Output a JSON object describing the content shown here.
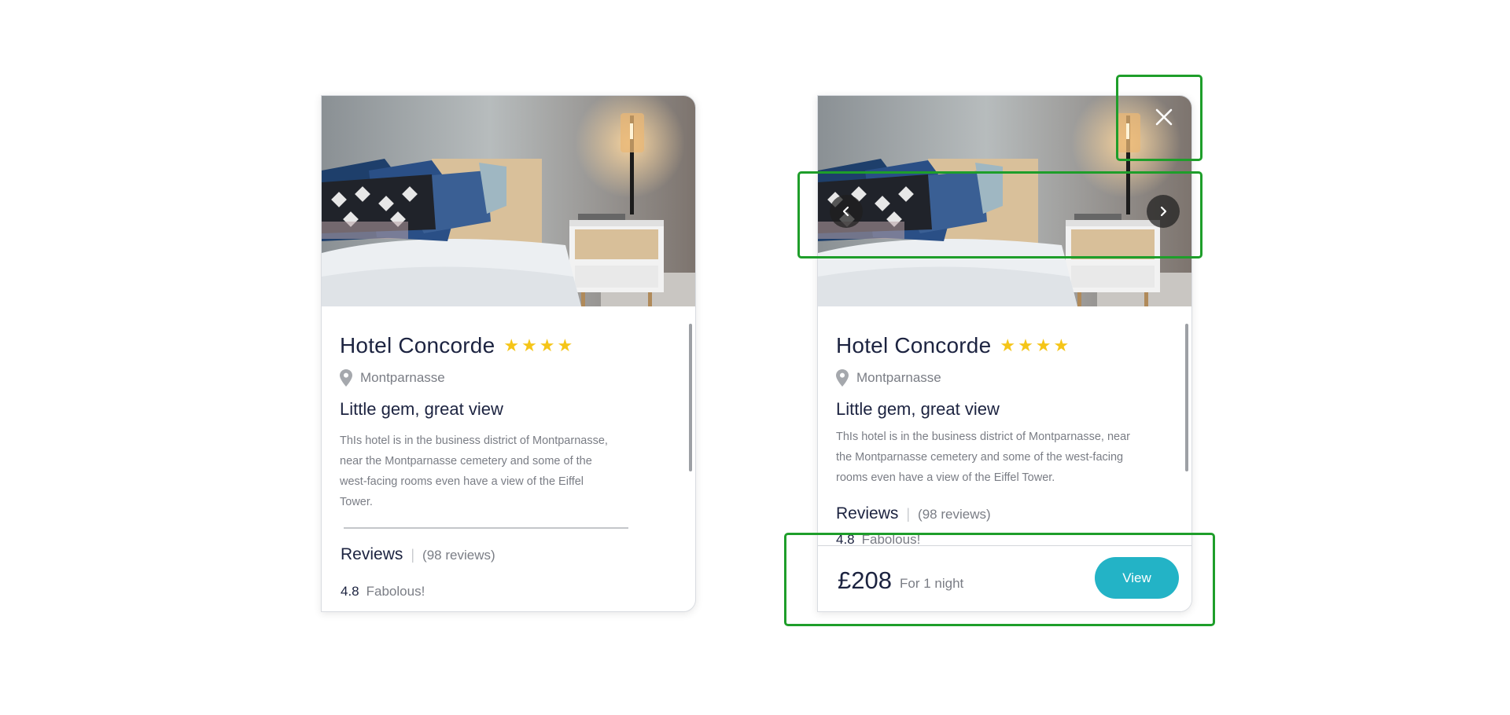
{
  "cards": [
    {
      "hotel_name": "Hotel Concorde",
      "stars": "★★★★",
      "location": "Montparnasse",
      "headline": "Little gem, great view",
      "description": [
        "ThIs hotel is in the business district of Montparnasse,",
        "near the Montparnasse cemetery and some of the",
        "west-facing rooms even have a view of the Eiffel",
        "Tower."
      ],
      "reviews_label": "Reviews",
      "reviews_count": "(98 reviews)",
      "rating_score": "4.8",
      "rating_text": "Fabolous!"
    },
    {
      "hotel_name": "Hotel Concorde",
      "stars": "★★★★",
      "location": "Montparnasse",
      "headline": "Little gem, great view",
      "description": [
        "ThIs hotel is in the business district of Montparnasse, near",
        "the Montparnasse cemetery and some of the west-facing",
        "rooms even have a view of the Eiffel Tower."
      ],
      "reviews_label": "Reviews",
      "reviews_count": "(98 reviews)",
      "rating_score": "4.8",
      "rating_text": "Fabolous!",
      "price": "£208",
      "price_note": "For 1 night",
      "view_button": "View"
    }
  ],
  "icons": {
    "location": "map-pin-icon",
    "close": "close-icon",
    "prev": "chevron-left-icon",
    "next": "chevron-right-icon"
  },
  "colors": {
    "accent": "#23b3c6",
    "stars": "#f5c518",
    "highlight": "#1e9e2a",
    "text": "#1c2340",
    "muted": "#7a7d85"
  }
}
